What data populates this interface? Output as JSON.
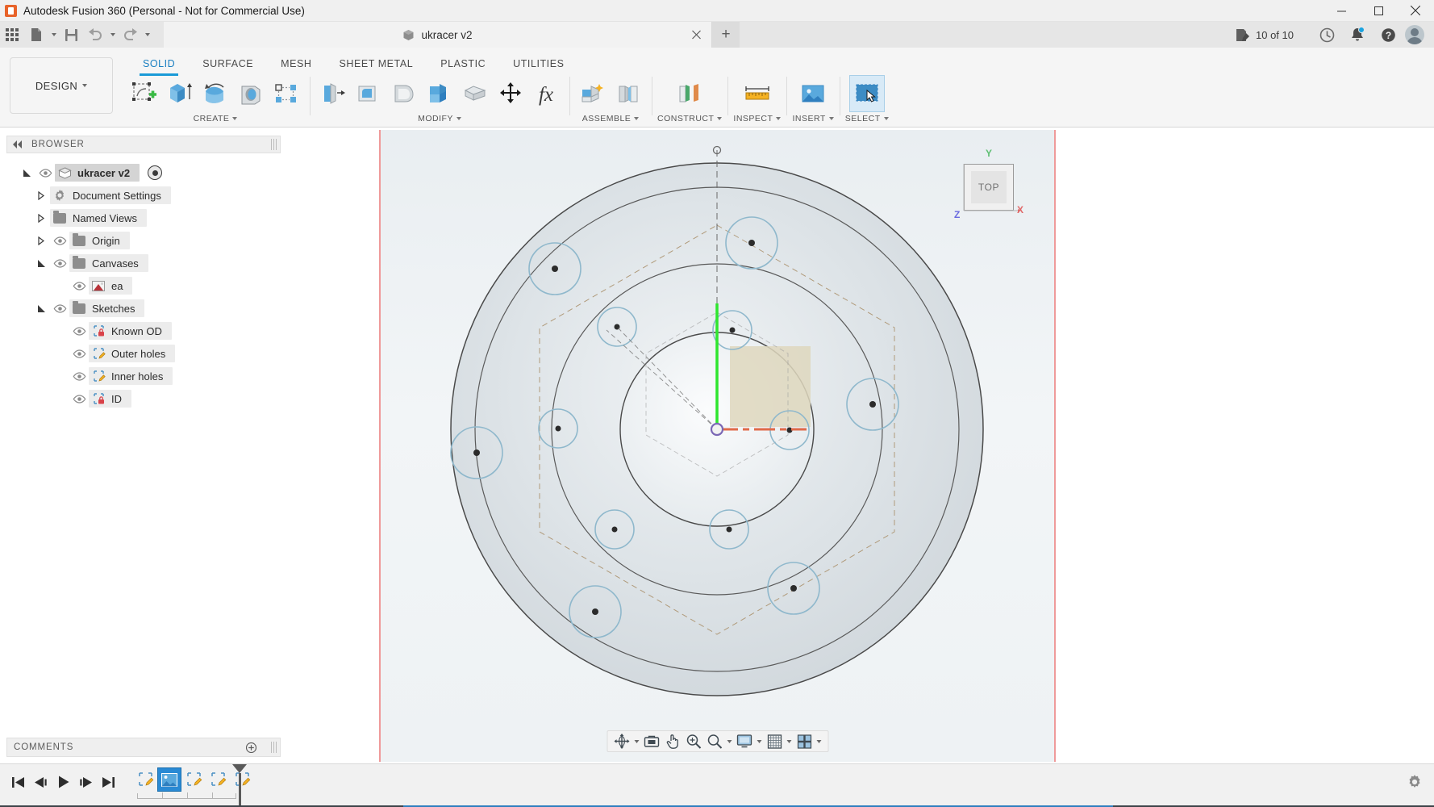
{
  "window": {
    "title": "Autodesk Fusion 360 (Personal - Not for Commercial Use)",
    "app_icon": "fusion-logo-icon",
    "minimize": "minimize-button",
    "maximize": "maximize-button",
    "close": "close-button"
  },
  "quick_access": {
    "app_grid": "app-grid-icon",
    "new_file": "new-file-icon",
    "save": "save-icon",
    "undo": "undo-icon",
    "redo": "redo-icon",
    "document_tab": {
      "label": "ukracer v2",
      "icon": "cube-icon",
      "close": "tab-close-icon"
    },
    "new_tab": "+",
    "doc_count": "10 of 10",
    "doc_count_icon": "documents-icon",
    "jobs_icon": "clock-icon",
    "notifications_icon": "bell-icon",
    "help_icon": "help-icon",
    "account_icon": "avatar-icon"
  },
  "ribbon": {
    "design_dropdown": "DESIGN",
    "workspace_tabs": [
      {
        "label": "SOLID",
        "active": true
      },
      {
        "label": "SURFACE",
        "active": false
      },
      {
        "label": "MESH",
        "active": false
      },
      {
        "label": "SHEET METAL",
        "active": false
      },
      {
        "label": "PLASTIC",
        "active": false
      },
      {
        "label": "UTILITIES",
        "active": false
      }
    ],
    "panels": [
      {
        "label": "CREATE",
        "tools": [
          {
            "name": "create-sketch-icon"
          },
          {
            "name": "extrude-icon"
          },
          {
            "name": "revolve-icon"
          },
          {
            "name": "hole-icon"
          },
          {
            "name": "pattern-icon"
          }
        ]
      },
      {
        "label": "MODIFY",
        "tools": [
          {
            "name": "press-pull-icon"
          },
          {
            "name": "fillet-icon"
          },
          {
            "name": "shell-icon"
          },
          {
            "name": "draft-icon"
          },
          {
            "name": "scale-icon"
          },
          {
            "name": "move-copy-icon"
          },
          {
            "name": "change-parameters-icon"
          }
        ]
      },
      {
        "label": "ASSEMBLE",
        "tools": [
          {
            "name": "new-component-icon"
          },
          {
            "name": "joint-icon"
          }
        ]
      },
      {
        "label": "CONSTRUCT",
        "tools": [
          {
            "name": "offset-plane-icon"
          }
        ]
      },
      {
        "label": "INSPECT",
        "tools": [
          {
            "name": "measure-icon"
          }
        ]
      },
      {
        "label": "INSERT",
        "tools": [
          {
            "name": "insert-canvas-icon"
          }
        ]
      },
      {
        "label": "SELECT",
        "tools": [
          {
            "name": "select-window-icon",
            "selected": true
          }
        ]
      }
    ]
  },
  "browser": {
    "header": "BROWSER",
    "collapse_icon": "collapse-left-icon",
    "tree": [
      {
        "label": "ukracer v2",
        "indent": 0,
        "twist": "expanded",
        "eye": true,
        "icon": "cube-icon",
        "radio": true,
        "root": true
      },
      {
        "label": "Document Settings",
        "indent": 1,
        "twist": "collapsed",
        "eye": false,
        "icon": "gear-icon"
      },
      {
        "label": "Named Views",
        "indent": 1,
        "twist": "collapsed",
        "eye": false,
        "icon": "folder-icon"
      },
      {
        "label": "Origin",
        "indent": 1,
        "twist": "collapsed",
        "eye": true,
        "icon": "folder-icon"
      },
      {
        "label": "Canvases",
        "indent": 1,
        "twist": "expanded",
        "eye": true,
        "icon": "folder-icon"
      },
      {
        "label": "ea",
        "indent": 2,
        "twist": "none",
        "eye": true,
        "icon": "image-icon"
      },
      {
        "label": "Sketches",
        "indent": 1,
        "twist": "expanded",
        "eye": true,
        "icon": "folder-icon"
      },
      {
        "label": "Known OD",
        "indent": 2,
        "twist": "none",
        "eye": true,
        "icon": "sketch-locked-icon"
      },
      {
        "label": "Outer holes",
        "indent": 2,
        "twist": "none",
        "eye": true,
        "icon": "sketch-edit-icon"
      },
      {
        "label": "Inner holes",
        "indent": 2,
        "twist": "none",
        "eye": true,
        "icon": "sketch-edit-icon"
      },
      {
        "label": "ID",
        "indent": 2,
        "twist": "none",
        "eye": true,
        "icon": "sketch-locked-icon"
      }
    ]
  },
  "comments": {
    "header": "COMMENTS",
    "add_icon": "add-comment-icon"
  },
  "canvas": {
    "view_cube": {
      "face_label": "TOP",
      "axis_y": "Y",
      "axis_x": "X",
      "axis_z": "Z",
      "axis_y_color": "#5fbf73",
      "axis_x_color": "#e06a6a",
      "axis_z_color": "#6a6ae0"
    },
    "nav_bar": [
      {
        "name": "orbit-icon",
        "caret": true
      },
      {
        "name": "look-at-icon",
        "caret": false
      },
      {
        "name": "pan-icon",
        "caret": false
      },
      {
        "name": "zoom-icon",
        "caret": false
      },
      {
        "name": "zoom-window-icon",
        "caret": true
      },
      {
        "name": "display-settings-icon",
        "caret": true
      },
      {
        "name": "grid-snaps-icon",
        "caret": true
      },
      {
        "name": "viewports-icon",
        "caret": true
      }
    ],
    "sketch": {
      "origin_point_color": "#7b68b5",
      "y_axis_color": "#2ee62e",
      "x_axis_color": "#e06a4a",
      "hole_circle_color": "#8fb8cc",
      "construction_line_color": "#b09a7a",
      "outer_hole_count": 6,
      "inner_hole_count": 6
    }
  },
  "timeline": {
    "controls": [
      {
        "name": "go-to-beginning-icon"
      },
      {
        "name": "step-back-icon"
      },
      {
        "name": "play-icon"
      },
      {
        "name": "step-forward-icon"
      },
      {
        "name": "go-to-end-icon"
      }
    ],
    "nodes": [
      {
        "name": "sketch-node-1",
        "icon": "sketch-edit-icon",
        "active": false
      },
      {
        "name": "canvas-node",
        "icon": "image-icon",
        "active": true
      },
      {
        "name": "sketch-node-2",
        "icon": "sketch-edit-icon",
        "active": false
      },
      {
        "name": "sketch-node-3",
        "icon": "sketch-edit-icon",
        "active": false
      },
      {
        "name": "sketch-node-4",
        "icon": "sketch-edit-icon",
        "active": false
      }
    ],
    "settings_icon": "timeline-settings-icon"
  }
}
